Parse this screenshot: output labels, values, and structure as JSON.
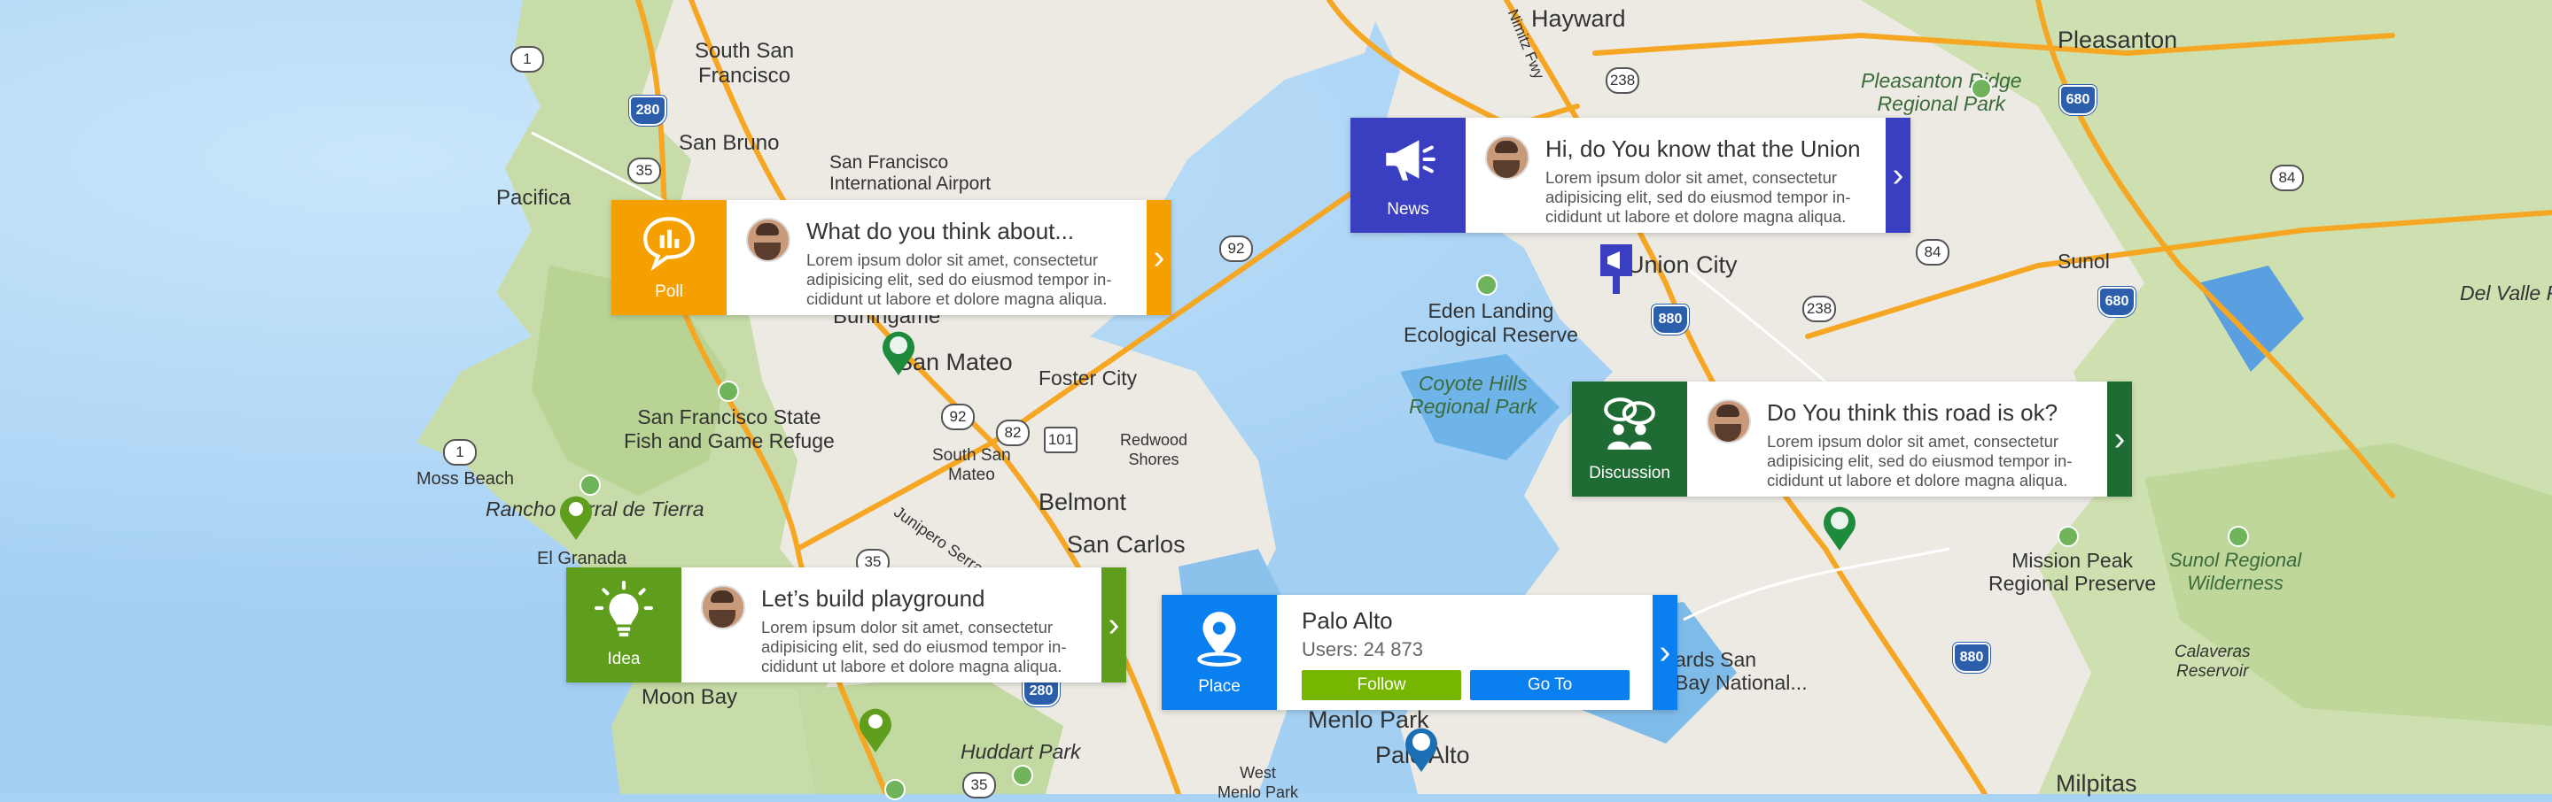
{
  "map": {
    "labels": {
      "hayward": "Hayward",
      "pleasanton": "Pleasanton",
      "south_san_francisco": "South San\nFrancisco",
      "san_bruno": "San Bruno",
      "sfo": "San Francisco\nInternational Airport",
      "pacifica": "Pacifica",
      "pleasanton_ridge": "Pleasanton Ridge\nRegional Park",
      "nimitz": "Nimitz Fwy",
      "union_city": "Union City",
      "sunol": "Sunol",
      "del_valle": "Del Valle R",
      "eden_landing": "Eden Landing\nEcological Reserve",
      "coyote_hills": "Coyote Hills\nRegional Park",
      "burlingame": "Burlingame",
      "san_mateo": "San Mateo",
      "foster_city": "Foster City",
      "sf_state_fish": "San Francisco State\nFish and Game Refuge",
      "redwood_shores": "Redwood\nShores",
      "south_san_mateo": "South San\nMateo",
      "moss_beach": "Moss Beach",
      "rancho": "Rancho Corral de Tierra",
      "belmont": "Belmont",
      "el_granada": "El Granada",
      "san_carlos": "San Carlos",
      "junipero": "Junipero Serra",
      "mission_peak": "Mission Peak\nRegional Preserve",
      "sunol_regional": "Sunol Regional\nWilderness",
      "moon_bay": "Moon Bay",
      "huddart": "Huddart Park",
      "menlo_park": "Menlo Park",
      "palo_alto": "Palo Alto",
      "west_menlo": "West\nMenlo Park",
      "calaveras": "Calaveras\nReservoir",
      "milpitas": "Milpitas",
      "edwards": "ards San\nBay National..."
    },
    "shields": {
      "r1a": "1",
      "r280a": "280",
      "r35a": "35",
      "r238a": "238",
      "r680a": "680",
      "r84a": "84",
      "r92a": "92",
      "r84b": "84",
      "r238b": "238",
      "r880a": "880",
      "r680b": "680",
      "r1b": "1",
      "r92b": "92",
      "r82": "82",
      "r101": "101",
      "r35b": "35",
      "r280b": "280",
      "r880b": "880",
      "r35c": "35"
    }
  },
  "cards": {
    "poll": {
      "tile_label": "Poll",
      "title": "What do you think about...",
      "text": "Lorem ipsum dolor sit amet, consectetur adipisicing elit, sed do eiusmod tempor in-cididunt ut labore et dolore magna aliqua.",
      "color": "#f5a000"
    },
    "news": {
      "tile_label": "News",
      "title": "Hi, do You know that the Union",
      "text": "Lorem ipsum dolor sit amet, consectetur adipisicing elit, sed do eiusmod tempor in-cididunt ut labore et dolore magna aliqua.",
      "color": "#3a3fc2"
    },
    "discussion": {
      "tile_label": "Discussion",
      "title": "Do You think this road is ok?",
      "text": "Lorem ipsum dolor sit amet, consectetur adipisicing elit, sed do eiusmod tempor in-cididunt ut labore et dolore magna aliqua.",
      "color": "#1e6b33"
    },
    "idea": {
      "tile_label": "Idea",
      "title": "Let’s build playground",
      "text": "Lorem ipsum dolor sit amet, consectetur adipisicing elit, sed do eiusmod tempor in-cididunt ut labore et dolore magna aliqua.",
      "color": "#5e9e1c"
    },
    "place": {
      "tile_label": "Place",
      "title": "Palo Alto",
      "users": "Users: 24 873",
      "follow": "Follow",
      "goto": "Go To",
      "color": "#0a7ff0",
      "follow_color": "#76b500",
      "goto_color": "#0a7ff0"
    }
  }
}
